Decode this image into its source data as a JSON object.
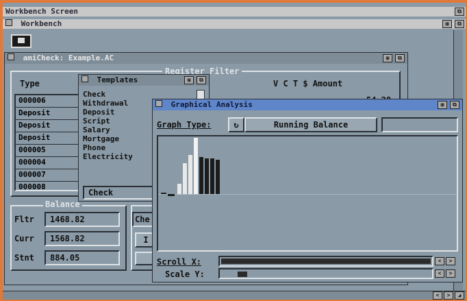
{
  "screen": {
    "title": "Workbench Screen"
  },
  "workbench": {
    "title": "Workbench"
  },
  "amicheck": {
    "title": "amiCheck: Example.AC",
    "register_filter_label": "Register Filter",
    "type_header": "Type",
    "cols_header": "V C T $ Amount",
    "partial_amount": "54.28",
    "rows": [
      "000006",
      "Deposit",
      "Deposit",
      "Deposit",
      "000005",
      "000004",
      "000007",
      "000008"
    ],
    "balance_label": "Balance",
    "fltr_label": "Fltr",
    "fltr_value": "1468.82",
    "curr_label": "Curr",
    "curr_value": "1568.82",
    "stnt_label": "Stnt",
    "stnt_value": "884.05",
    "che_partial": "Che",
    "btn_partial": "I"
  },
  "templates": {
    "title": "Templates",
    "items": [
      "Check",
      "Withdrawal",
      "Deposit",
      "Script",
      "Salary",
      "Mortgage",
      "Phone",
      "Electricity"
    ],
    "selected": "Check"
  },
  "graph": {
    "title": "Graphical Analysis",
    "graph_type_label": "Graph Type:",
    "graph_type_value": "Running Balance",
    "scroll_x_label": "Scroll X:",
    "scale_y_label": "Scale Y:",
    "bars": [
      {
        "value": 0.18,
        "color": "#e8e8e8"
      },
      {
        "value": 0.55,
        "color": "#e8e8e8"
      },
      {
        "value": 0.7,
        "color": "#e8e8e8"
      },
      {
        "value": 1.0,
        "color": "#f2f2f2"
      },
      {
        "value": 0.66,
        "color": "#1c1c1c"
      },
      {
        "value": 0.64,
        "color": "#1c1c1c"
      },
      {
        "value": 0.63,
        "color": "#1c1c1c"
      },
      {
        "value": 0.61,
        "color": "#1c1c1c"
      }
    ],
    "scale_y_level": 0.05
  }
}
